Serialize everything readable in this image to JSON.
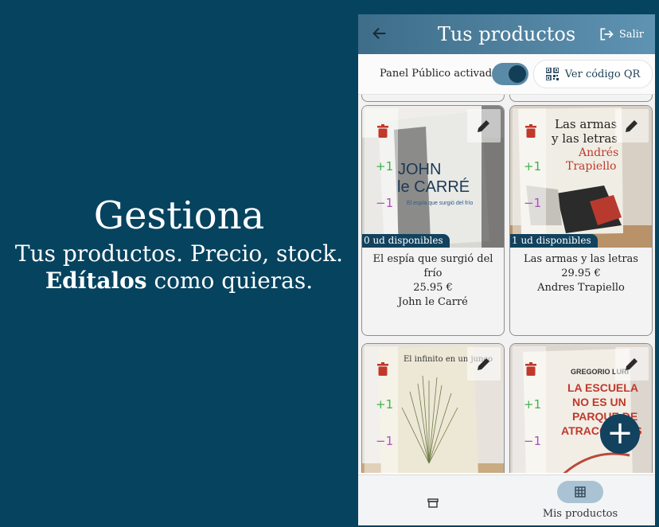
{
  "promo": {
    "headline": "Gestiona",
    "line1": "Tus productos. Precio, stock.",
    "line2_bold": "Edítalos",
    "line2_rest": " como quieras."
  },
  "topbar": {
    "title": "Tus productos",
    "logout_label": "Salir",
    "back_icon": "arrow-left-icon",
    "logout_icon": "logout-icon"
  },
  "controls": {
    "panel_label": "Panel Público activado",
    "panel_toggle_on": true,
    "qr_button_label": "Ver código QR",
    "qr_icon": "qr-code-icon"
  },
  "products": [
    {
      "title": "El espía que surgió del frío",
      "price": "25.95 €",
      "author": "John le Carré",
      "stock": "0 ud disponibles",
      "increment": "+1",
      "decrement": "−1",
      "cover_texts": [
        "JOHN",
        "le CARRÉ",
        "El espía que surgió del frío"
      ]
    },
    {
      "title": "Las armas y las letras",
      "price": "29.95 €",
      "author": "Andres Trapiello",
      "stock": "1 ud disponibles",
      "increment": "+1",
      "decrement": "−1",
      "cover_texts": [
        "Las armas",
        "y las letras",
        "Andrés",
        "Trapiello"
      ]
    },
    {
      "increment": "+1",
      "decrement": "−1",
      "cover_texts": [
        "El infinito en un junco"
      ]
    },
    {
      "increment": "+1",
      "decrement": "−1",
      "cover_texts": [
        "GREGORIO LURI",
        "LA ESCUELA",
        "NO ES UN",
        "PARQUE DE",
        "ATRACCIONES"
      ]
    }
  ],
  "fab_icon": "plus-icon",
  "bottom_nav": {
    "store_icon": "store-icon",
    "grid_icon": "grid-icon",
    "products_label": "Mis productos"
  },
  "colors": {
    "background": "#06435f",
    "topbar_start": "#3d6d89",
    "topbar_end": "#5f93b2",
    "dark_accent": "#12425e",
    "increment": "#3cb54a",
    "decrement": "#b04ec0",
    "delete": "#c0392b"
  }
}
